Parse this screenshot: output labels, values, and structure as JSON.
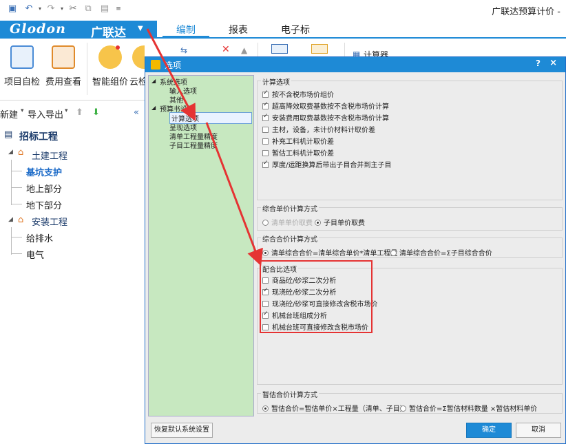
{
  "app": {
    "title": "广联达预算计价 -"
  },
  "logo": {
    "brand": "Glodon",
    "brand_cn": "广联达"
  },
  "tabs": [
    "编制",
    "报表",
    "电子标"
  ],
  "ribbon": {
    "buttons": [
      "项目自检",
      "费用查看",
      "智能组价",
      "云检"
    ],
    "partial": "计算器"
  },
  "left": {
    "tools": [
      "新建",
      "导入导出"
    ],
    "tree": [
      "招标工程",
      "土建工程",
      "基坑支护",
      "地上部分",
      "地下部分",
      "安装工程",
      "给排水",
      "电气"
    ]
  },
  "dialog": {
    "title": "选项",
    "help": "?",
    "close": "×",
    "tree": [
      "系统选项",
      "输入选项",
      "其他",
      "预算书设置",
      "计算选项",
      "呈现选项",
      "清单工程量精度",
      "子目工程量精度"
    ],
    "calc": {
      "title": "计算选项",
      "options": [
        {
          "label": "按不含税市场价组价",
          "checked": true
        },
        {
          "label": "超高降效取费基数按不含税市场价计算",
          "checked": true
        },
        {
          "label": "安装费用取费基数按不含税市场价计算",
          "checked": true
        },
        {
          "label": "主材，设备，未计价材料计取价差",
          "checked": false
        },
        {
          "label": "补充工料机计取价差",
          "checked": false
        },
        {
          "label": "暂估工料机计取价差",
          "checked": false
        },
        {
          "label": "厚度/运距换算后带出子目合并到主子目",
          "checked": true
        }
      ]
    },
    "unit_price": {
      "title": "综合单价计算方式",
      "opt1": "清单单价取费",
      "opt2": "子目单价取费"
    },
    "total_price": {
      "title": "综合合价计算方式",
      "opt1": "清单综合合价=清单综合单价*清单工程量",
      "opt2": "清单综合合价=Σ子目综合合价"
    },
    "mix": {
      "title": "配合比选项",
      "options": [
        {
          "label": "商品砼/砂浆二次分析",
          "checked": false
        },
        {
          "label": "现浇砼/砂浆二次分析",
          "checked": true
        },
        {
          "label": "现浇砼/砂浆可直接修改含税市场价",
          "checked": false
        },
        {
          "label": "机械台班组成分析",
          "checked": true
        },
        {
          "label": "机械台班可直接修改含税市场价",
          "checked": false
        }
      ]
    },
    "estimate": {
      "title": "暂估合价计算方式",
      "opt1": "暂估合价=暂估单价×工程量（清单、子目）",
      "opt2": "暂估合价=Σ暂估材料数量 ×暂估材料单价"
    },
    "buttons": {
      "reset": "恢复默认系统设置",
      "ok": "确定",
      "cancel": "取消"
    }
  },
  "colors": {
    "accent": "#1e8ad6",
    "tree_bg": "#c7e8c0",
    "highlight": "#e53333"
  }
}
